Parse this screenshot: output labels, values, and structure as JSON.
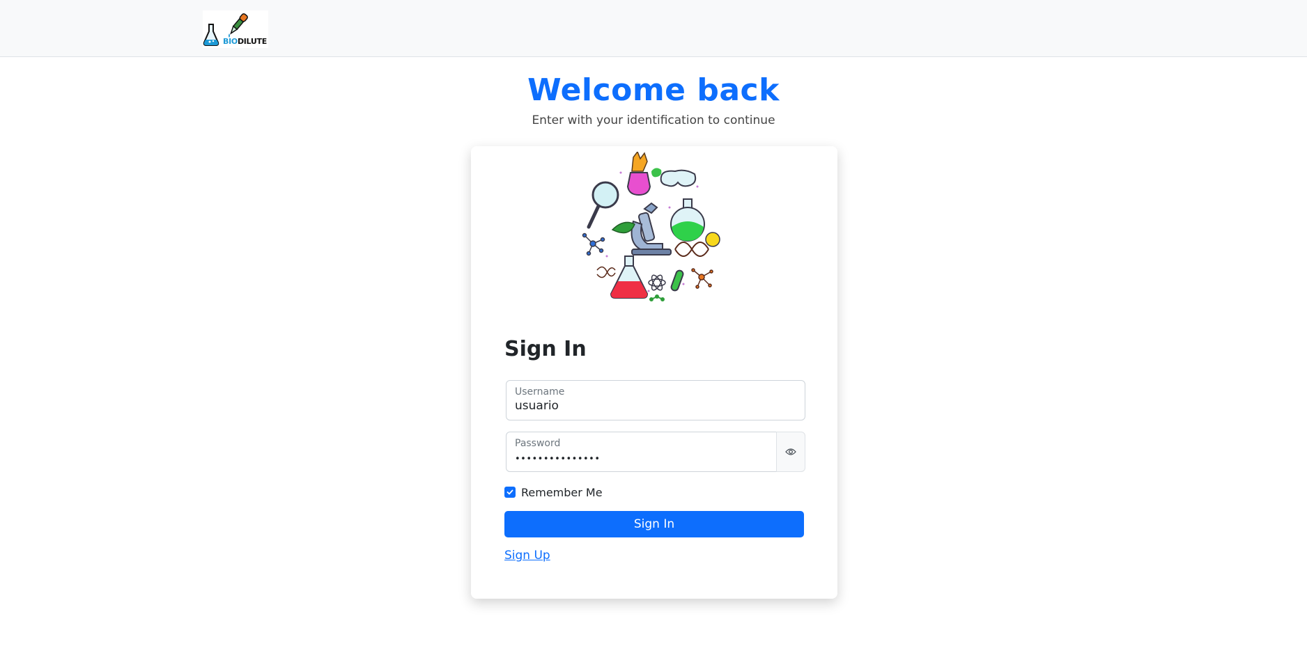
{
  "navbar": {
    "logo_text_bio": "BIO",
    "logo_text_dilute": "DILUTE",
    "logo_icon": "flask-dropper-logo-icon"
  },
  "header": {
    "title": "Welcome back",
    "subtitle": "Enter with your identification to continue"
  },
  "card": {
    "illustration_icon": "science-lab-illustration",
    "title": "Sign In",
    "username": {
      "label": "Username",
      "value": "usuario"
    },
    "password": {
      "label": "Password",
      "value": "•••••••••••••••",
      "toggle_icon": "eye-icon"
    },
    "remember": {
      "label": "Remember Me",
      "checked": true
    },
    "submit_label": "Sign In",
    "signup_label": "Sign Up"
  },
  "colors": {
    "primary": "#0d6efd",
    "navbar_bg": "#f8f9fa",
    "logo_blue": "#1e9ad6"
  }
}
